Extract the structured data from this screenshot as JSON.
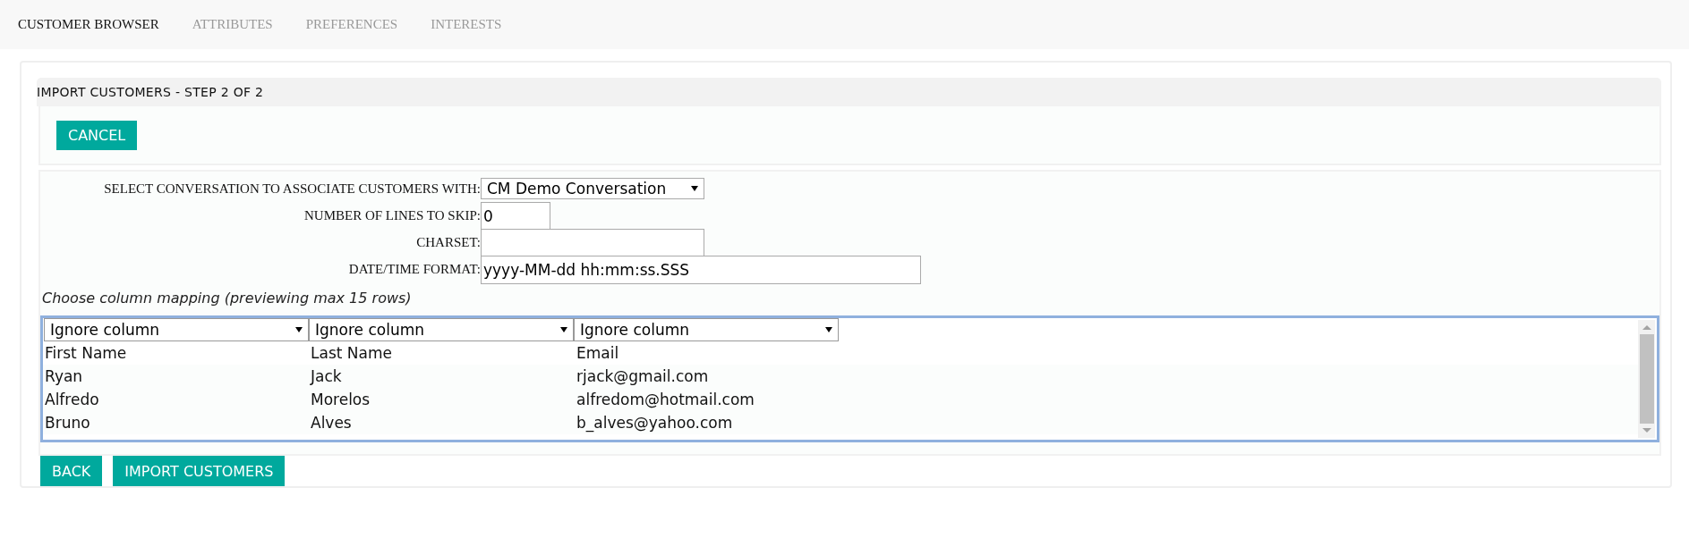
{
  "tabs": [
    {
      "label": "CUSTOMER BROWSER",
      "selected": true
    },
    {
      "label": "ATTRIBUTES",
      "selected": false
    },
    {
      "label": "PREFERENCES",
      "selected": false
    },
    {
      "label": "INTERESTS",
      "selected": false
    }
  ],
  "panel": {
    "title": "IMPORT CUSTOMERS - STEP 2 OF 2",
    "cancel_button": "CANCEL"
  },
  "form": {
    "fields": [
      {
        "label": "SELECT CONVERSATION TO ASSOCIATE CUSTOMERS WITH:",
        "kind": "dropdown",
        "value": "CM Demo Conversation"
      },
      {
        "label": "NUMBER OF LINES TO SKIP:",
        "kind": "text",
        "value": "0"
      },
      {
        "label": "CHARSET:",
        "kind": "text"
      },
      {
        "label": "DATE/TIME FORMAT:",
        "kind": "text",
        "value": "yyyy-MM-dd hh:mm:ss.SSS"
      }
    ]
  },
  "mapping": {
    "caption": "Choose column mapping (previewing max 15 rows)",
    "column_mappings": [
      "Ignore column",
      "Ignore column",
      "Ignore column"
    ],
    "rows": [
      [
        "First Name",
        "Last Name",
        "Email"
      ],
      [
        "Ryan",
        "Jack",
        "rjack@gmail.com"
      ],
      [
        "Alfredo",
        "Morelos",
        "alfredom@hotmail.com"
      ],
      [
        "Bruno",
        "Alves",
        "b_alves@yahoo.com"
      ]
    ]
  },
  "buttons": [
    "BACK",
    "IMPORT CUSTOMERS"
  ]
}
